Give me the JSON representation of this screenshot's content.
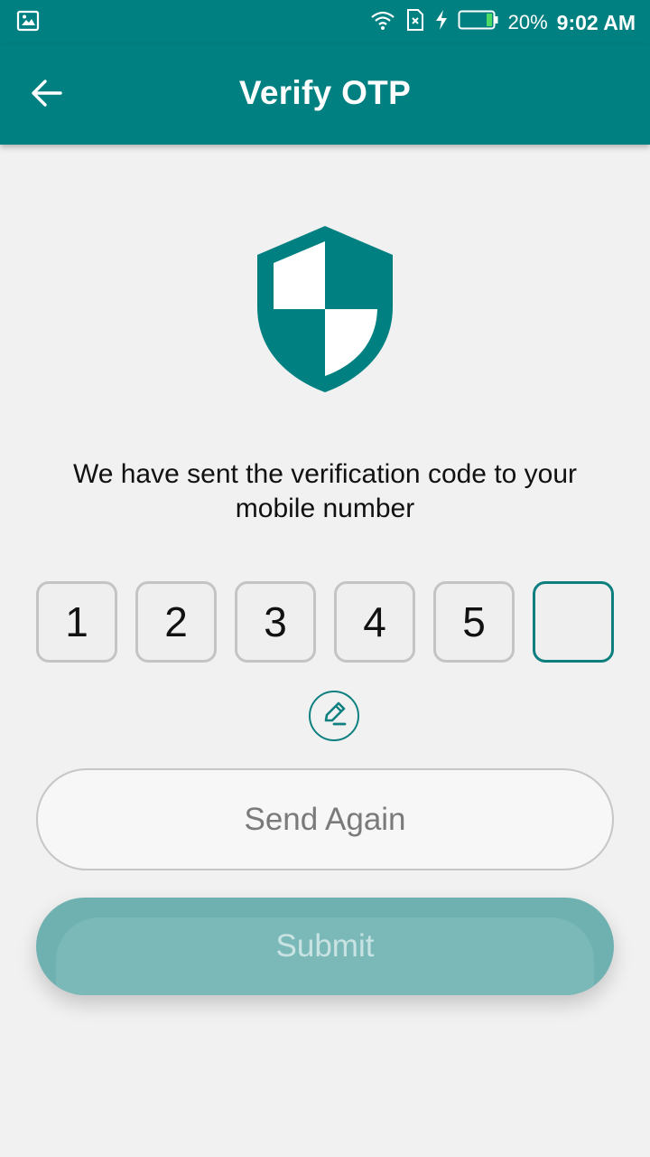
{
  "status_bar": {
    "battery": "20%",
    "time": "9:02 AM"
  },
  "appbar": {
    "title": "Verify OTP"
  },
  "message": "We have sent the verification code to your mobile number",
  "otp": {
    "digits": [
      "1",
      "2",
      "3",
      "4",
      "5",
      ""
    ]
  },
  "buttons": {
    "send_again": "Send Again",
    "submit": "Submit"
  },
  "colors": {
    "primary": "#008080",
    "background": "#f1f1f1",
    "submit_disabled": "#7bb9b9"
  },
  "icons": {
    "status_left": "image-icon",
    "wifi": "wifi-icon",
    "sim": "sim-error-icon",
    "charging": "charging-icon",
    "battery": "battery-icon",
    "back": "arrow-left-icon",
    "shield": "shield-icon",
    "edit": "pencil-icon"
  }
}
